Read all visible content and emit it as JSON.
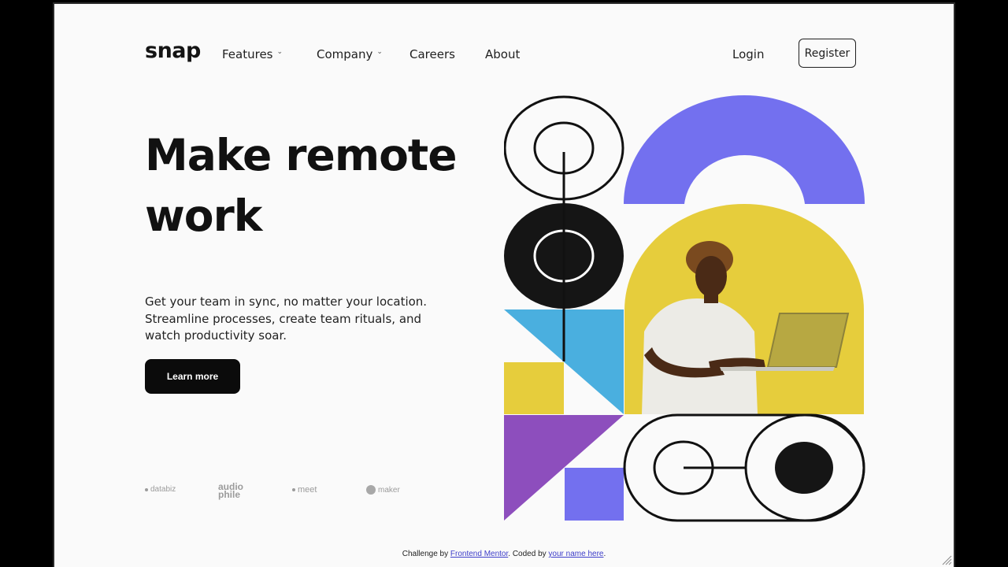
{
  "brand": {
    "logo": "snap"
  },
  "nav": {
    "features": "Features",
    "company": "Company",
    "careers": "Careers",
    "about": "About",
    "login": "Login",
    "register": "Register"
  },
  "hero": {
    "title_line1": "Make remote",
    "title_line2": "work",
    "description": "Get your team in sync, no matter your location. Streamline processes, create team rituals, and watch productivity soar.",
    "cta": "Learn more"
  },
  "clients": {
    "databiz": "databiz",
    "audiophile_line1": "audio",
    "audiophile_line2": "phile",
    "meet": "meet",
    "maker": "maker"
  },
  "footer": {
    "prefix": "Challenge by ",
    "mentor_link": "Frontend Mentor",
    "middle": ". Coded by ",
    "author_link": "your name here",
    "suffix": "."
  },
  "colors": {
    "purple_arch": "#7370ef",
    "yellow": "#e6cd3c",
    "blue": "#4aafdf",
    "violet": "#8d4ebd",
    "square": "#7370ef",
    "black": "#151515"
  }
}
